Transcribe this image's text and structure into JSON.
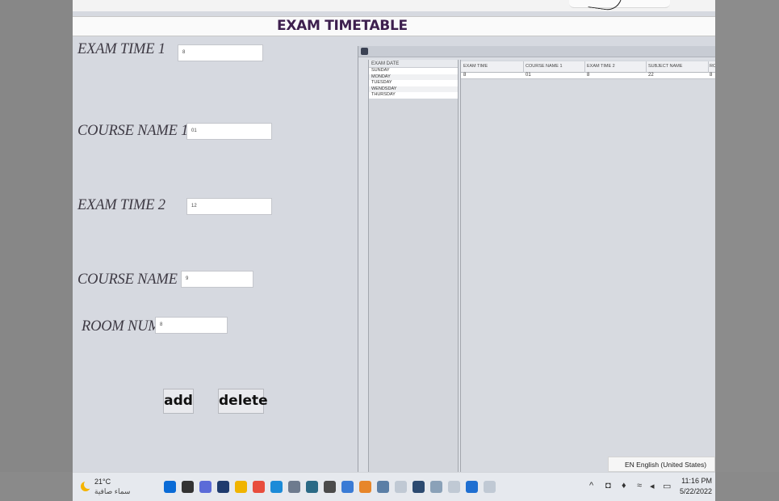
{
  "window": {
    "title": "EXAM TIMETABLE"
  },
  "form": {
    "exam_time_1": {
      "label": "EXAM TIME 1",
      "value": "8"
    },
    "course_name_1": {
      "label": "COURSE NAME 1",
      "value": "01"
    },
    "exam_time_2": {
      "label": "EXAM TIME 2",
      "value": "12"
    },
    "course_name_2": {
      "label": "COURSE NAME 2",
      "value": "9"
    },
    "room_num": {
      "label": "ROOM NUM",
      "value": "8"
    }
  },
  "buttons": {
    "add": "add",
    "delete": "delete"
  },
  "days_list": {
    "header": "EXAM DATE",
    "items": [
      "SUNDAY",
      "MONDAY",
      "TUESDAY",
      "WENDSDAY",
      "THURSDAY"
    ]
  },
  "table": {
    "columns": [
      "EXAM TIME",
      "COURSE NAME 1",
      "EXAM TIME 2",
      "SUBJECT NAME",
      "RO"
    ],
    "rows": [
      [
        "8",
        "01",
        "8",
        "22",
        "8"
      ]
    ]
  },
  "ime": {
    "label": "EN English (United States)"
  },
  "taskbar": {
    "temperature": "21°C",
    "condition": "سماء صافية",
    "time": "11:16 PM",
    "date": "5/22/2022",
    "icon_colors": [
      "#0a6bd6",
      "#333333",
      "#5b6bd8",
      "#1f3b6e",
      "#f0b400",
      "#e84d3d",
      "#1c8bd8",
      "#6e7b8e",
      "#2b6a86",
      "#4b4b4b",
      "#3a7bd5",
      "#e7862a",
      "#5b7fa6",
      "#c0c9d4",
      "#2c4a70",
      "#8aa1b8",
      "#c0c9d4",
      "#1f6fd1",
      "#c0c9d4"
    ]
  }
}
